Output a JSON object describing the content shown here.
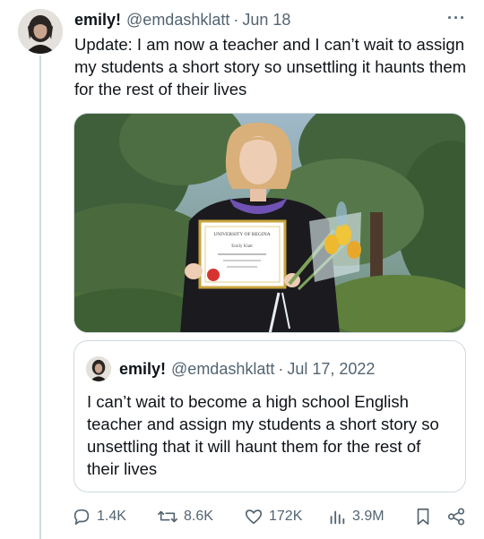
{
  "tweet": {
    "author_name": "emily!",
    "handle": "@emdashklatt",
    "separator": "·",
    "date": "Jun 18",
    "more": "···",
    "text": "Update: I am now a teacher and I can’t wait to assign my students a short story so unsettling it haunts them for the rest of their lives"
  },
  "media": {
    "certificate_title": "UNIVERSITY OF REGINA",
    "certificate_name": "Emily Klatt"
  },
  "quoted_tweet": {
    "author_name": "emily!",
    "handle": "@emdashklatt",
    "separator": "·",
    "date": "Jul 17, 2022",
    "text": "I can’t wait to become a high school English teacher and assign my students a short story so unsettling that it will haunt them for the rest of their lives"
  },
  "actions": {
    "replies": "1.4K",
    "retweets": "8.6K",
    "likes": "172K",
    "views": "3.9M",
    "icons": [
      "reply-icon",
      "retweet-icon",
      "like-icon",
      "views-icon",
      "bookmark-icon",
      "share-icon"
    ]
  },
  "colors": {
    "text": "#0f1419",
    "secondary": "#536471",
    "border": "#cfd9de"
  }
}
